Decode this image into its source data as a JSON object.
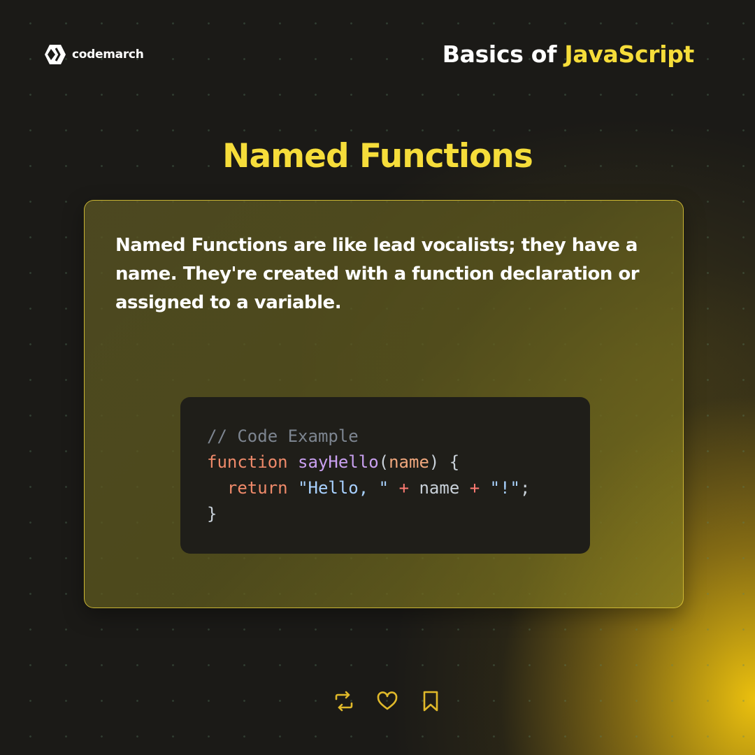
{
  "brand": {
    "name": "codemarch",
    "logo_icon": "codemarch-logo-icon"
  },
  "header": {
    "title_prefix": "Basics of ",
    "title_accent": "JavaScript"
  },
  "page": {
    "title": "Named Functions"
  },
  "card": {
    "description": "Named Functions are like lead vocalists; they have a name. They're created with a function declaration or assigned to a variable."
  },
  "code": {
    "comment": "// Code Example",
    "line2_kw": "function",
    "line2_fn": "sayHello",
    "line2_open": "(",
    "line2_param": "name",
    "line2_close": ") {",
    "line3_kw": "return",
    "line3_str1": "\"Hello, \"",
    "line3_op1": "+",
    "line3_ident": "name",
    "line3_op2": "+",
    "line3_str2": "\"!\"",
    "line3_end": ";",
    "line4": "}"
  },
  "actions": [
    {
      "icon": "repost-icon"
    },
    {
      "icon": "heart-icon"
    },
    {
      "icon": "bookmark-icon"
    }
  ],
  "colors": {
    "accent": "#f6dd3a",
    "background": "#1b1a17",
    "icon": "#e0b92a"
  }
}
